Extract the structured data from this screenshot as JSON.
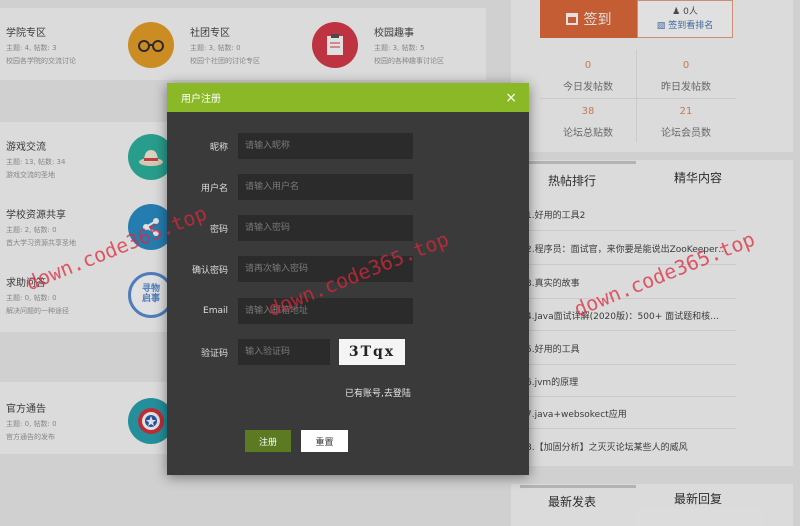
{
  "forums": [
    {
      "title": "学院专区",
      "stats": "主题: 4, 帖数: 3",
      "desc": "校园各学院的交流讨论",
      "icon": "glasses-icon",
      "color": "#e8a02a"
    },
    {
      "title": "社团专区",
      "stats": "主题: 3, 帖数: 0",
      "desc": "校园个社团的讨论专区",
      "icon": "",
      "color": ""
    },
    {
      "title": "校园趣事",
      "stats": "主题: 3, 帖数: 5",
      "desc": "校园的各种趣事讨论区",
      "icon": "clipboard-icon",
      "color": "#d83b4a"
    },
    {
      "title": "游戏交流",
      "stats": "主题: 13, 帖数: 34",
      "desc": "游戏交流的圣地",
      "icon": "hat-icon",
      "color": "#2fb3a0"
    },
    {
      "title": "学校资源共享",
      "stats": "主题: 2, 帖数: 0",
      "desc": "首大学习资源共享圣地",
      "icon": "share-icon",
      "color": "#2b8fc8"
    },
    {
      "title": "求助问答",
      "stats": "主题: 0, 帖数: 0",
      "desc": "解决问题的一种途径",
      "icon": "badge-icon",
      "color": "#5b8fd6",
      "badge_text": "寻物启事"
    },
    {
      "title": "官方通告",
      "stats": "主题: 0, 帖数: 0",
      "desc": "官方通告的发布",
      "icon": "shield-icon",
      "color": "#2aa3b0"
    }
  ],
  "signin": {
    "button": "签到",
    "count": "0人",
    "rank_link": "签到看排名"
  },
  "stats": [
    {
      "num": "0",
      "label": "今日发帖数"
    },
    {
      "num": "0",
      "label": "昨日发帖数"
    },
    {
      "num": "38",
      "label": "论坛总贴数"
    },
    {
      "num": "21",
      "label": "论坛会员数"
    }
  ],
  "tabs": {
    "hot": "热帖排行",
    "featured": "精华内容",
    "latest": "最新发表",
    "reply": "最新回复"
  },
  "hot_posts": [
    "1.好用的工具2",
    "2.程序员：面试官，来你要是能说出ZooKeeper…",
    "3.真实的故事",
    "4.Java面试详解(2020版)：500+ 面试题和核…",
    "5.好用的工具",
    "6.jvm的原理",
    "7.java+websokect应用",
    "8.【加固分析】之灭灭论坛某些人的威风"
  ],
  "modal": {
    "title": "用户注册",
    "close": "×",
    "fields": {
      "nickname": {
        "label": "昵称",
        "placeholder": "请输入昵称"
      },
      "username": {
        "label": "用户名",
        "placeholder": "请输入用户名"
      },
      "password": {
        "label": "密码",
        "placeholder": "请输入密码"
      },
      "confirm": {
        "label": "确认密码",
        "placeholder": "请再次输入密码"
      },
      "email": {
        "label": "Email",
        "placeholder": "请输入邮箱地址"
      },
      "captcha": {
        "label": "验证码",
        "placeholder": "输入验证码",
        "code": "3Tqx"
      }
    },
    "login_link": "已有账号,去登陆",
    "register_btn": "注册",
    "reset_btn": "重置"
  },
  "watermark": "down.code365.top"
}
